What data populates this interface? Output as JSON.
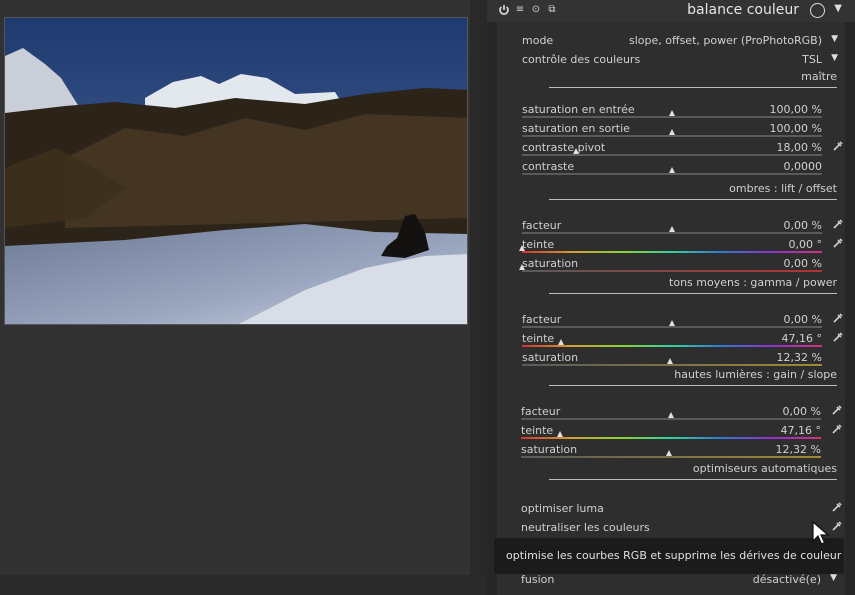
{
  "module": {
    "title": "balance couleur"
  },
  "rows": {
    "mode": {
      "label": "mode",
      "value": "slope, offset, power (ProPhotoRGB)"
    },
    "color_control": {
      "label": "contrôle des couleurs",
      "value": "TSL"
    },
    "input_saturation": {
      "label": "saturation en entrée",
      "value": "100,00 %",
      "level": 0.5
    },
    "output_saturation": {
      "label": "saturation en sortie",
      "value": "100,00 %",
      "level": 0.5
    },
    "contrast_pivot": {
      "label": "contraste pivot",
      "value": "18,00 %",
      "level": 0.18
    },
    "contrast": {
      "label": "contraste",
      "value": "0,0000",
      "level": 0.5
    },
    "shadows_factor": {
      "label": "facteur",
      "value": "0,00 %",
      "level": 0.5
    },
    "shadows_hue": {
      "label": "teinte",
      "value": "0,00 °",
      "level": 0.0
    },
    "shadows_saturation": {
      "label": "saturation",
      "value": "0,00 %",
      "level": 0.0
    },
    "midtones_factor": {
      "label": "facteur",
      "value": "0,00 %",
      "level": 0.5
    },
    "midtones_hue": {
      "label": "teinte",
      "value": "47,16 °",
      "level": 0.131
    },
    "midtones_saturation": {
      "label": "saturation",
      "value": "12,32 %",
      "level": 0.493
    },
    "highlights_factor": {
      "label": "facteur",
      "value": "0,00 %",
      "level": 0.5
    },
    "highlights_hue": {
      "label": "teinte",
      "value": "47,16 °",
      "level": 0.131
    },
    "highlights_saturation": {
      "label": "saturation",
      "value": "12,32 %",
      "level": 0.493
    },
    "optimize_luma": {
      "label": "optimiser luma"
    },
    "neutralize_colors": {
      "label": "neutraliser les couleurs"
    },
    "blend": {
      "label": "fusion",
      "value": "désactivé(e)"
    }
  },
  "sections": {
    "master": "maître",
    "shadows": "ombres : lift / offset",
    "midtones": "tons moyens : gamma / power",
    "highlights": "hautes lumières : gain / slope",
    "auto": "optimiseurs automatiques"
  },
  "tooltip": {
    "text": "optimise les courbes RGB et supprime les dérives de couleur"
  },
  "colors": {
    "panel_bg": "#2e2e2e",
    "header_bg": "#333333",
    "text": "#d0d0d0",
    "tooltip_bg": "#1b1b1b"
  }
}
